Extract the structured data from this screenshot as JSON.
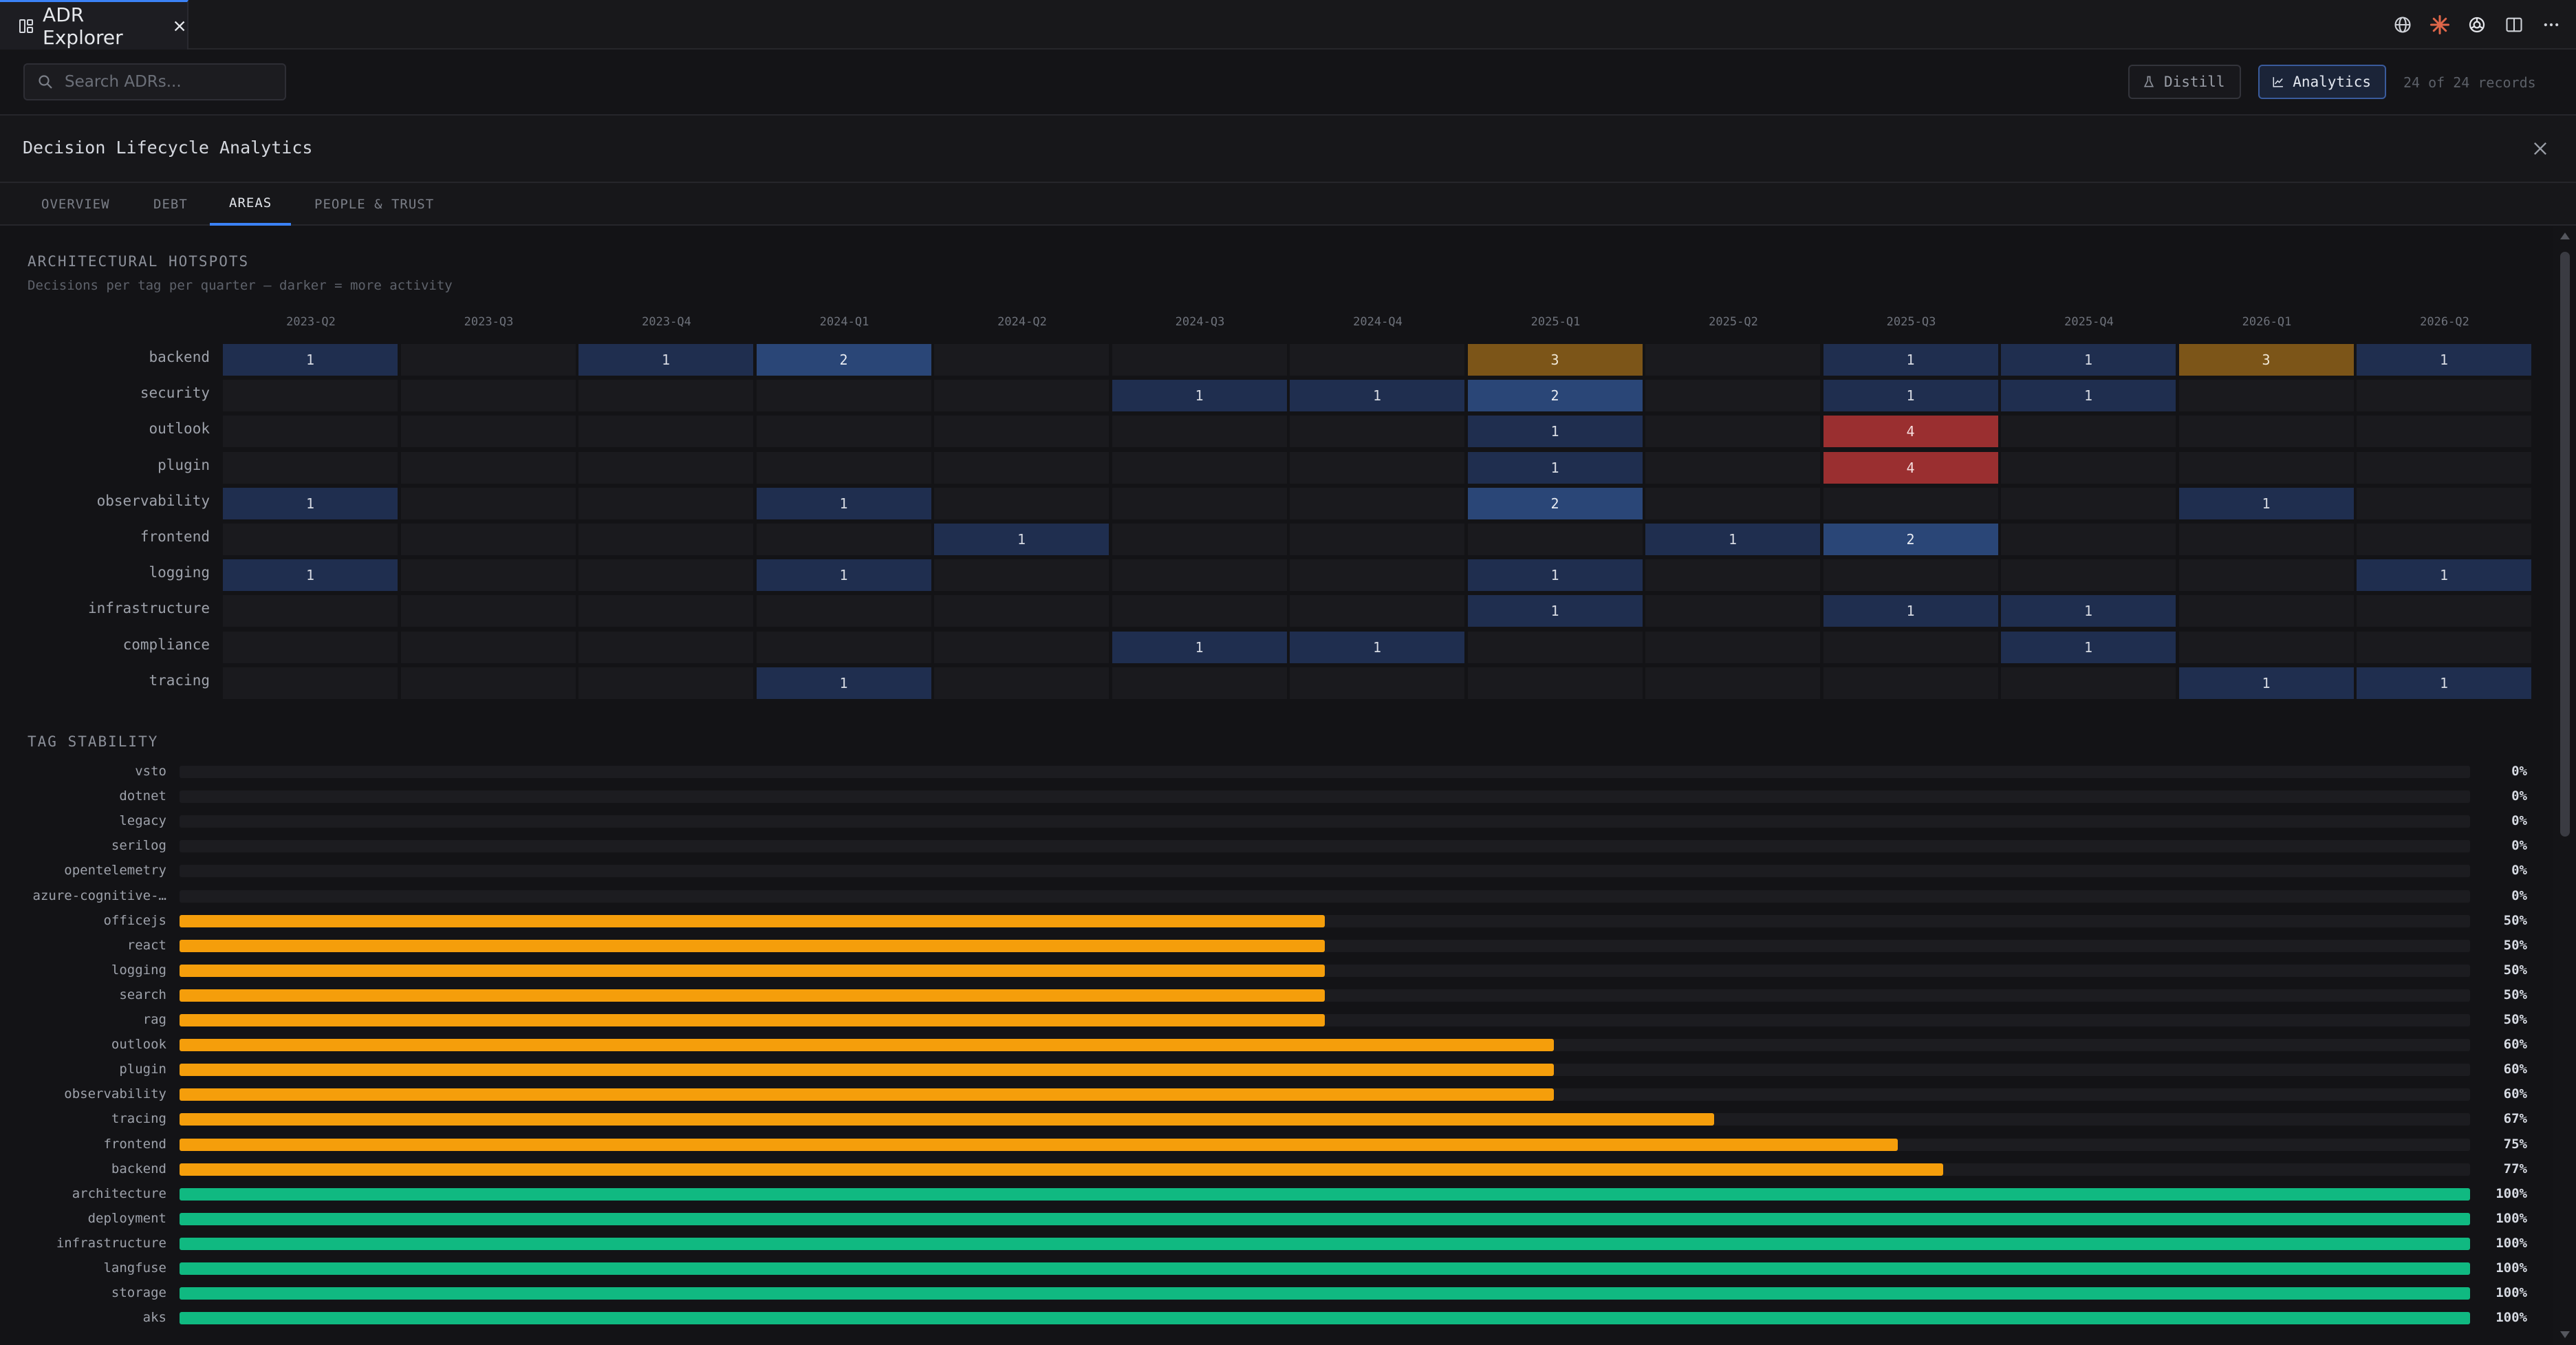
{
  "window": {
    "tab_title": "ADR Explorer",
    "actions": [
      "globe-icon",
      "sparkle-icon",
      "openai-icon",
      "split-view-icon",
      "more-icon"
    ]
  },
  "toolbar": {
    "search_placeholder": "Search ADRs...",
    "distill_label": "Distill",
    "analytics_label": "Analytics",
    "record_count": "24 of 24 records"
  },
  "panel": {
    "title": "Decision Lifecycle Analytics",
    "tabs": [
      {
        "label": "OVERVIEW",
        "active": false
      },
      {
        "label": "DEBT",
        "active": false
      },
      {
        "label": "AREAS",
        "active": true
      },
      {
        "label": "PEOPLE & TRUST",
        "active": false
      }
    ]
  },
  "hotspots": {
    "title": "ARCHITECTURAL HOTSPOTS",
    "subtitle": "Decisions per tag per quarter — darker = more activity",
    "quarters": [
      "2023-Q2",
      "2023-Q3",
      "2023-Q4",
      "2024-Q1",
      "2024-Q2",
      "2024-Q3",
      "2024-Q4",
      "2025-Q1",
      "2025-Q2",
      "2025-Q3",
      "2025-Q4",
      "2026-Q1",
      "2026-Q2"
    ],
    "rows": [
      {
        "tag": "backend",
        "values": [
          1,
          0,
          1,
          2,
          0,
          0,
          0,
          3,
          0,
          1,
          1,
          3,
          1
        ]
      },
      {
        "tag": "security",
        "values": [
          0,
          0,
          0,
          0,
          0,
          1,
          1,
          2,
          0,
          1,
          1,
          0,
          0
        ]
      },
      {
        "tag": "outlook",
        "values": [
          0,
          0,
          0,
          0,
          0,
          0,
          0,
          1,
          0,
          4,
          0,
          0,
          0
        ]
      },
      {
        "tag": "plugin",
        "values": [
          0,
          0,
          0,
          0,
          0,
          0,
          0,
          1,
          0,
          4,
          0,
          0,
          0
        ]
      },
      {
        "tag": "observability",
        "values": [
          1,
          0,
          0,
          1,
          0,
          0,
          0,
          2,
          0,
          0,
          0,
          1,
          0
        ]
      },
      {
        "tag": "frontend",
        "values": [
          0,
          0,
          0,
          0,
          1,
          0,
          0,
          0,
          1,
          2,
          0,
          0,
          0
        ]
      },
      {
        "tag": "logging",
        "values": [
          1,
          0,
          0,
          1,
          0,
          0,
          0,
          1,
          0,
          0,
          0,
          0,
          1
        ]
      },
      {
        "tag": "infrastructure",
        "values": [
          0,
          0,
          0,
          0,
          0,
          0,
          0,
          1,
          0,
          1,
          1,
          0,
          0
        ]
      },
      {
        "tag": "compliance",
        "values": [
          0,
          0,
          0,
          0,
          0,
          1,
          1,
          0,
          0,
          0,
          1,
          0,
          0
        ]
      },
      {
        "tag": "tracing",
        "values": [
          0,
          0,
          0,
          1,
          0,
          0,
          0,
          0,
          0,
          0,
          0,
          1,
          1
        ]
      }
    ]
  },
  "stability": {
    "title": "TAG STABILITY",
    "colors": {
      "low": "#f59e0b",
      "high": "#10b981"
    },
    "rows": [
      {
        "tag": "vsto",
        "pct": 0,
        "label": "0%"
      },
      {
        "tag": "dotnet",
        "pct": 0,
        "label": "0%"
      },
      {
        "tag": "legacy",
        "pct": 0,
        "label": "0%"
      },
      {
        "tag": "serilog",
        "pct": 0,
        "label": "0%"
      },
      {
        "tag": "opentelemetry",
        "pct": 0,
        "label": "0%"
      },
      {
        "tag": "azure-cognitive-…",
        "pct": 0,
        "label": "0%"
      },
      {
        "tag": "officejs",
        "pct": 50,
        "label": "50%"
      },
      {
        "tag": "react",
        "pct": 50,
        "label": "50%"
      },
      {
        "tag": "logging",
        "pct": 50,
        "label": "50%"
      },
      {
        "tag": "search",
        "pct": 50,
        "label": "50%"
      },
      {
        "tag": "rag",
        "pct": 50,
        "label": "50%"
      },
      {
        "tag": "outlook",
        "pct": 60,
        "label": "60%"
      },
      {
        "tag": "plugin",
        "pct": 60,
        "label": "60%"
      },
      {
        "tag": "observability",
        "pct": 60,
        "label": "60%"
      },
      {
        "tag": "tracing",
        "pct": 67,
        "label": "67%"
      },
      {
        "tag": "frontend",
        "pct": 75,
        "label": "75%"
      },
      {
        "tag": "backend",
        "pct": 77,
        "label": "77%"
      },
      {
        "tag": "architecture",
        "pct": 100,
        "label": "100%"
      },
      {
        "tag": "deployment",
        "pct": 100,
        "label": "100%"
      },
      {
        "tag": "infrastructure",
        "pct": 100,
        "label": "100%"
      },
      {
        "tag": "langfuse",
        "pct": 100,
        "label": "100%"
      },
      {
        "tag": "storage",
        "pct": 100,
        "label": "100%"
      },
      {
        "tag": "aks",
        "pct": 100,
        "label": "100%"
      }
    ]
  }
}
